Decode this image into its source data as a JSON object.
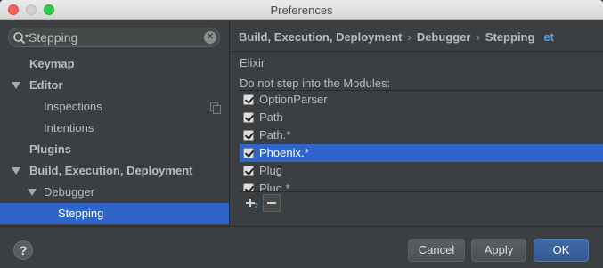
{
  "window": {
    "title": "Preferences"
  },
  "search": {
    "value": "Stepping",
    "placeholder": ""
  },
  "sidebar": {
    "items": [
      {
        "label": "Keymap"
      },
      {
        "label": "Editor"
      },
      {
        "label": "Inspections"
      },
      {
        "label": "Intentions"
      },
      {
        "label": "Plugins"
      },
      {
        "label": "Build, Execution, Deployment"
      },
      {
        "label": "Debugger"
      },
      {
        "label": "Stepping"
      }
    ]
  },
  "breadcrumb": {
    "items": [
      "Build, Execution, Deployment",
      "Debugger",
      "Stepping"
    ],
    "separator": "›",
    "trailing": "et"
  },
  "content": {
    "group_label": "Elixir",
    "list_title": "Do not step into the Modules:",
    "modules": [
      {
        "label": "OptionParser",
        "checked": true
      },
      {
        "label": "Path",
        "checked": true
      },
      {
        "label": "Path.*",
        "checked": true
      },
      {
        "label": "Phoenix.*",
        "checked": true,
        "selected": true
      },
      {
        "label": "Plug",
        "checked": true
      },
      {
        "label": "Plug.*",
        "checked": true
      }
    ]
  },
  "footer": {
    "help_label": "?",
    "cancel_label": "Cancel",
    "apply_label": "Apply",
    "ok_label": "OK"
  },
  "colors": {
    "background": "#3c3f41",
    "selection": "#2f65ca",
    "text": "#bbbbbb",
    "link": "#589df6",
    "ok_button": "#3f6aa8"
  }
}
